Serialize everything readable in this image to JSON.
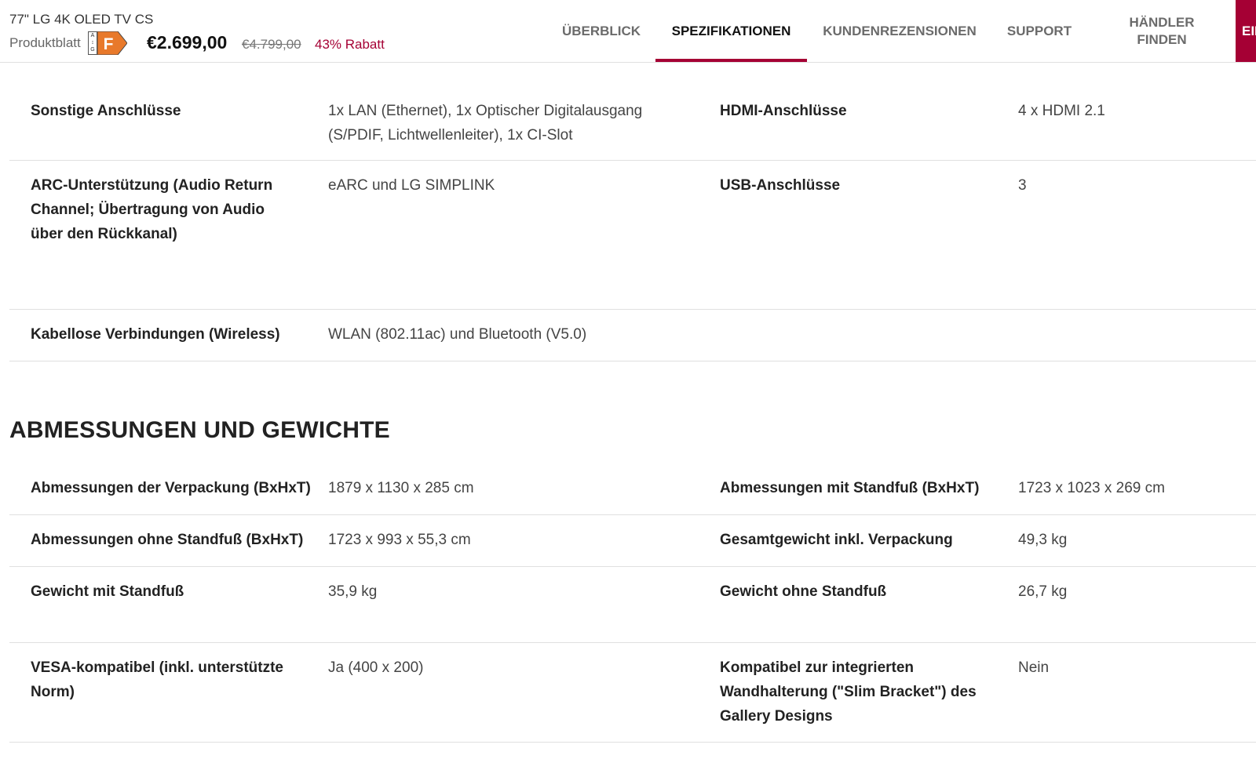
{
  "header": {
    "product_title": "77\" LG 4K OLED TV CS",
    "sheet_label": "Produktblatt",
    "energy_class": "F",
    "energy_scale_top": "A",
    "energy_scale_bottom": "G",
    "price": "€2.699,00",
    "old_price": "€4.799,00",
    "discount": "43% Rabatt"
  },
  "nav": {
    "tabs": [
      {
        "label": "ÜBERBLICK"
      },
      {
        "label": "SPEZIFIKATIONEN",
        "active": true
      },
      {
        "label": "KUNDENREZENSIONEN"
      },
      {
        "label": "SUPPORT"
      },
      {
        "label": "HÄNDLER FINDEN"
      }
    ],
    "cta_label": "EIN"
  },
  "connections": [
    {
      "label_left": "Sonstige Anschlüsse",
      "value_left": "1x LAN (Ethernet), 1x Optischer Digitalausgang (S/PDIF, Lichtwellenleiter), 1x CI-Slot",
      "label_right": "HDMI-Anschlüsse",
      "value_right": "4 x HDMI 2.1"
    },
    {
      "label_left": "ARC-Unterstützung (Audio Return Channel; Übertragung von Audio über den Rückkanal)",
      "value_left": "eARC und LG SIMPLINK",
      "label_right": "USB-Anschlüsse",
      "value_right": "3"
    },
    {
      "label_left": "Kabellose Verbindungen (Wireless)",
      "value_left": "WLAN (802.11ac) und Bluetooth (V5.0)",
      "label_right": "",
      "value_right": ""
    }
  ],
  "dimensions": {
    "heading": "ABMESSUNGEN UND GEWICHTE",
    "rows": [
      {
        "label_left": "Abmessungen der Verpackung (BxHxT)",
        "value_left": "1879 x 1130 x 285 cm",
        "label_right": "Abmessungen mit Standfuß (BxHxT)",
        "value_right": "1723 x 1023 x 269 cm"
      },
      {
        "label_left": "Abmessungen ohne Standfuß (BxHxT)",
        "value_left": "1723 x 993 x 55,3 cm",
        "label_right": "Gesamtgewicht inkl. Verpackung",
        "value_right": "49,3 kg"
      },
      {
        "label_left": "Gewicht mit Standfuß",
        "value_left": "35,9 kg",
        "label_right": "Gewicht ohne Standfuß",
        "value_right": "26,7 kg"
      },
      {
        "label_left": "VESA-kompatibel (inkl. unterstützte Norm)",
        "value_left": "Ja (400 x 200)",
        "label_right": "Kompatibel zur integrierten Wandhalterung (\"Slim Bracket\") des Gallery Designs",
        "value_right": "Nein"
      }
    ]
  },
  "colors": {
    "accent": "#a50034",
    "energy_f": "#e8792b"
  }
}
